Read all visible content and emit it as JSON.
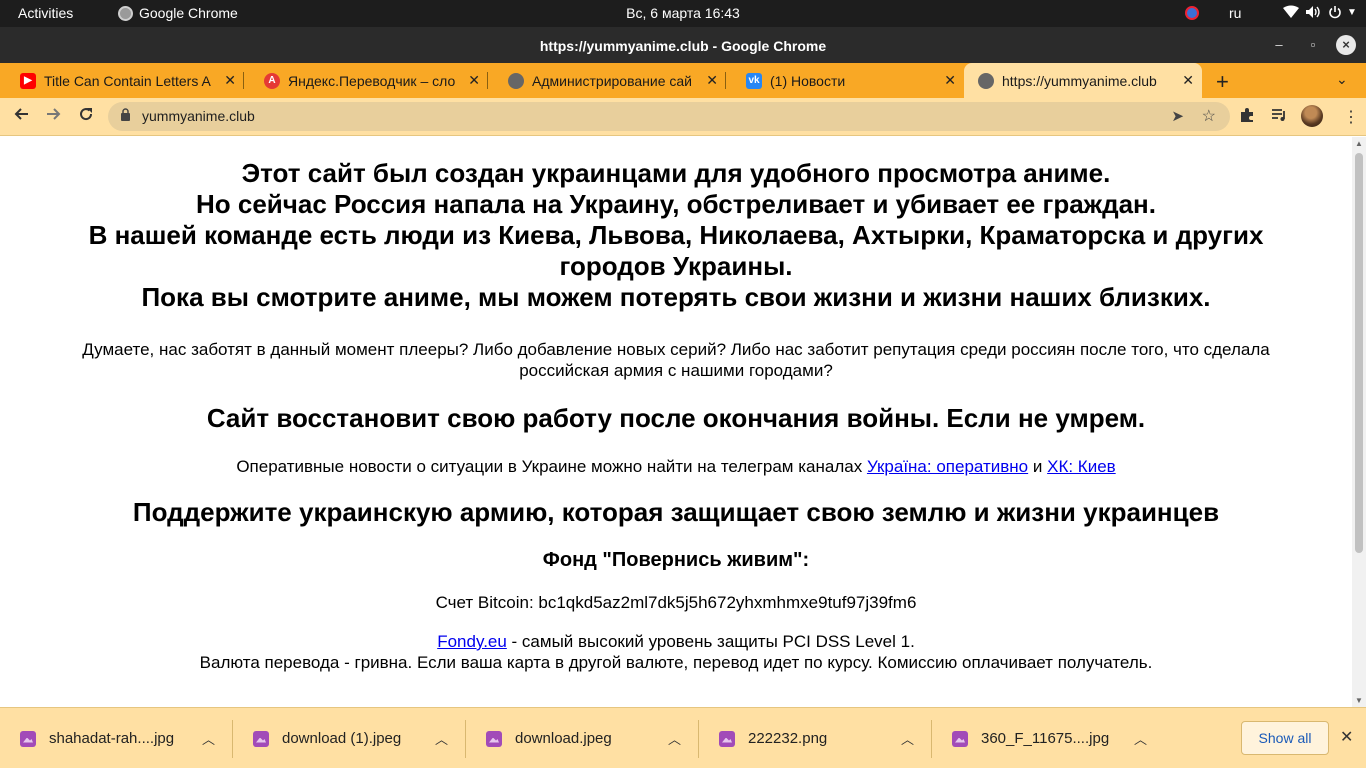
{
  "topbar": {
    "activities": "Activities",
    "app_name": "Google Chrome",
    "clock": "Вс, 6 марта  16:43",
    "lang": "ru"
  },
  "window": {
    "title": "https://yummyanime.club - Google Chrome"
  },
  "tabs": [
    {
      "label": "Title Can Contain Letters A",
      "icon": "youtube-icon",
      "color": "#ff0000"
    },
    {
      "label": "Яндекс.Переводчик – сло",
      "icon": "yandex-translate-icon",
      "color": "#e53935"
    },
    {
      "label": "Администрирование сай",
      "icon": "globe-icon",
      "color": "#666666"
    },
    {
      "label": "(1) Новости",
      "icon": "vk-icon",
      "color": "#2787f5"
    },
    {
      "label": "https://yummyanime.club",
      "icon": "globe-icon",
      "color": "#666666"
    }
  ],
  "toolbar": {
    "url": "yummyanime.club"
  },
  "page": {
    "heading_lines": [
      "Этот сайт был создан украинцами для удобного просмотра аниме.",
      "Но сейчас Россия напала на Украину, обстреливает и убивает ее граждан.",
      "В нашей команде есть люди из Киева, Львова, Николаева, Ахтырки, Краматорска и других городов Украины.",
      "Пока вы смотрите аниме, мы можем потерять свои жизни и жизни наших близких."
    ],
    "question": "Думаете, нас заботят в данный момент плееры? Либо добавление новых серий? Либо нас заботит репутация среди россиян после того, что сделала российская армия с нашими городами?",
    "restore": "Сайт восстановит свою работу после окончания войны. Если не умрем.",
    "news_prefix": "Оперативные новости о ситуации в Украине можно найти на телеграм каналах",
    "news_link1": "Україна: оперативно",
    "news_and": "и",
    "news_link2": "ХК: Киев",
    "support": "Поддержите украинскую армию, которая защищает свою землю и жизни украинцев",
    "fund": "Фонд \"Повернись живим\":",
    "bitcoin": "Счет Bitcoin: bc1qkd5az2ml7dk5j5h672yhxmhmxe9tuf97j39fm6",
    "fondy_link": "Fondy.eu",
    "fondy_text": " - самый высокий уровень защиты PCI DSS Level 1.",
    "currency": "Валюта перевода - гривна. Если ваша карта в другой валюте, перевод идет по курсу. Комиссию оплачивает получатель."
  },
  "downloads": {
    "items": [
      "shahadat-rah....jpg",
      "download (1).jpeg",
      "download.jpeg",
      "222232.png",
      "360_F_11675....jpg"
    ],
    "show_all": "Show all"
  }
}
